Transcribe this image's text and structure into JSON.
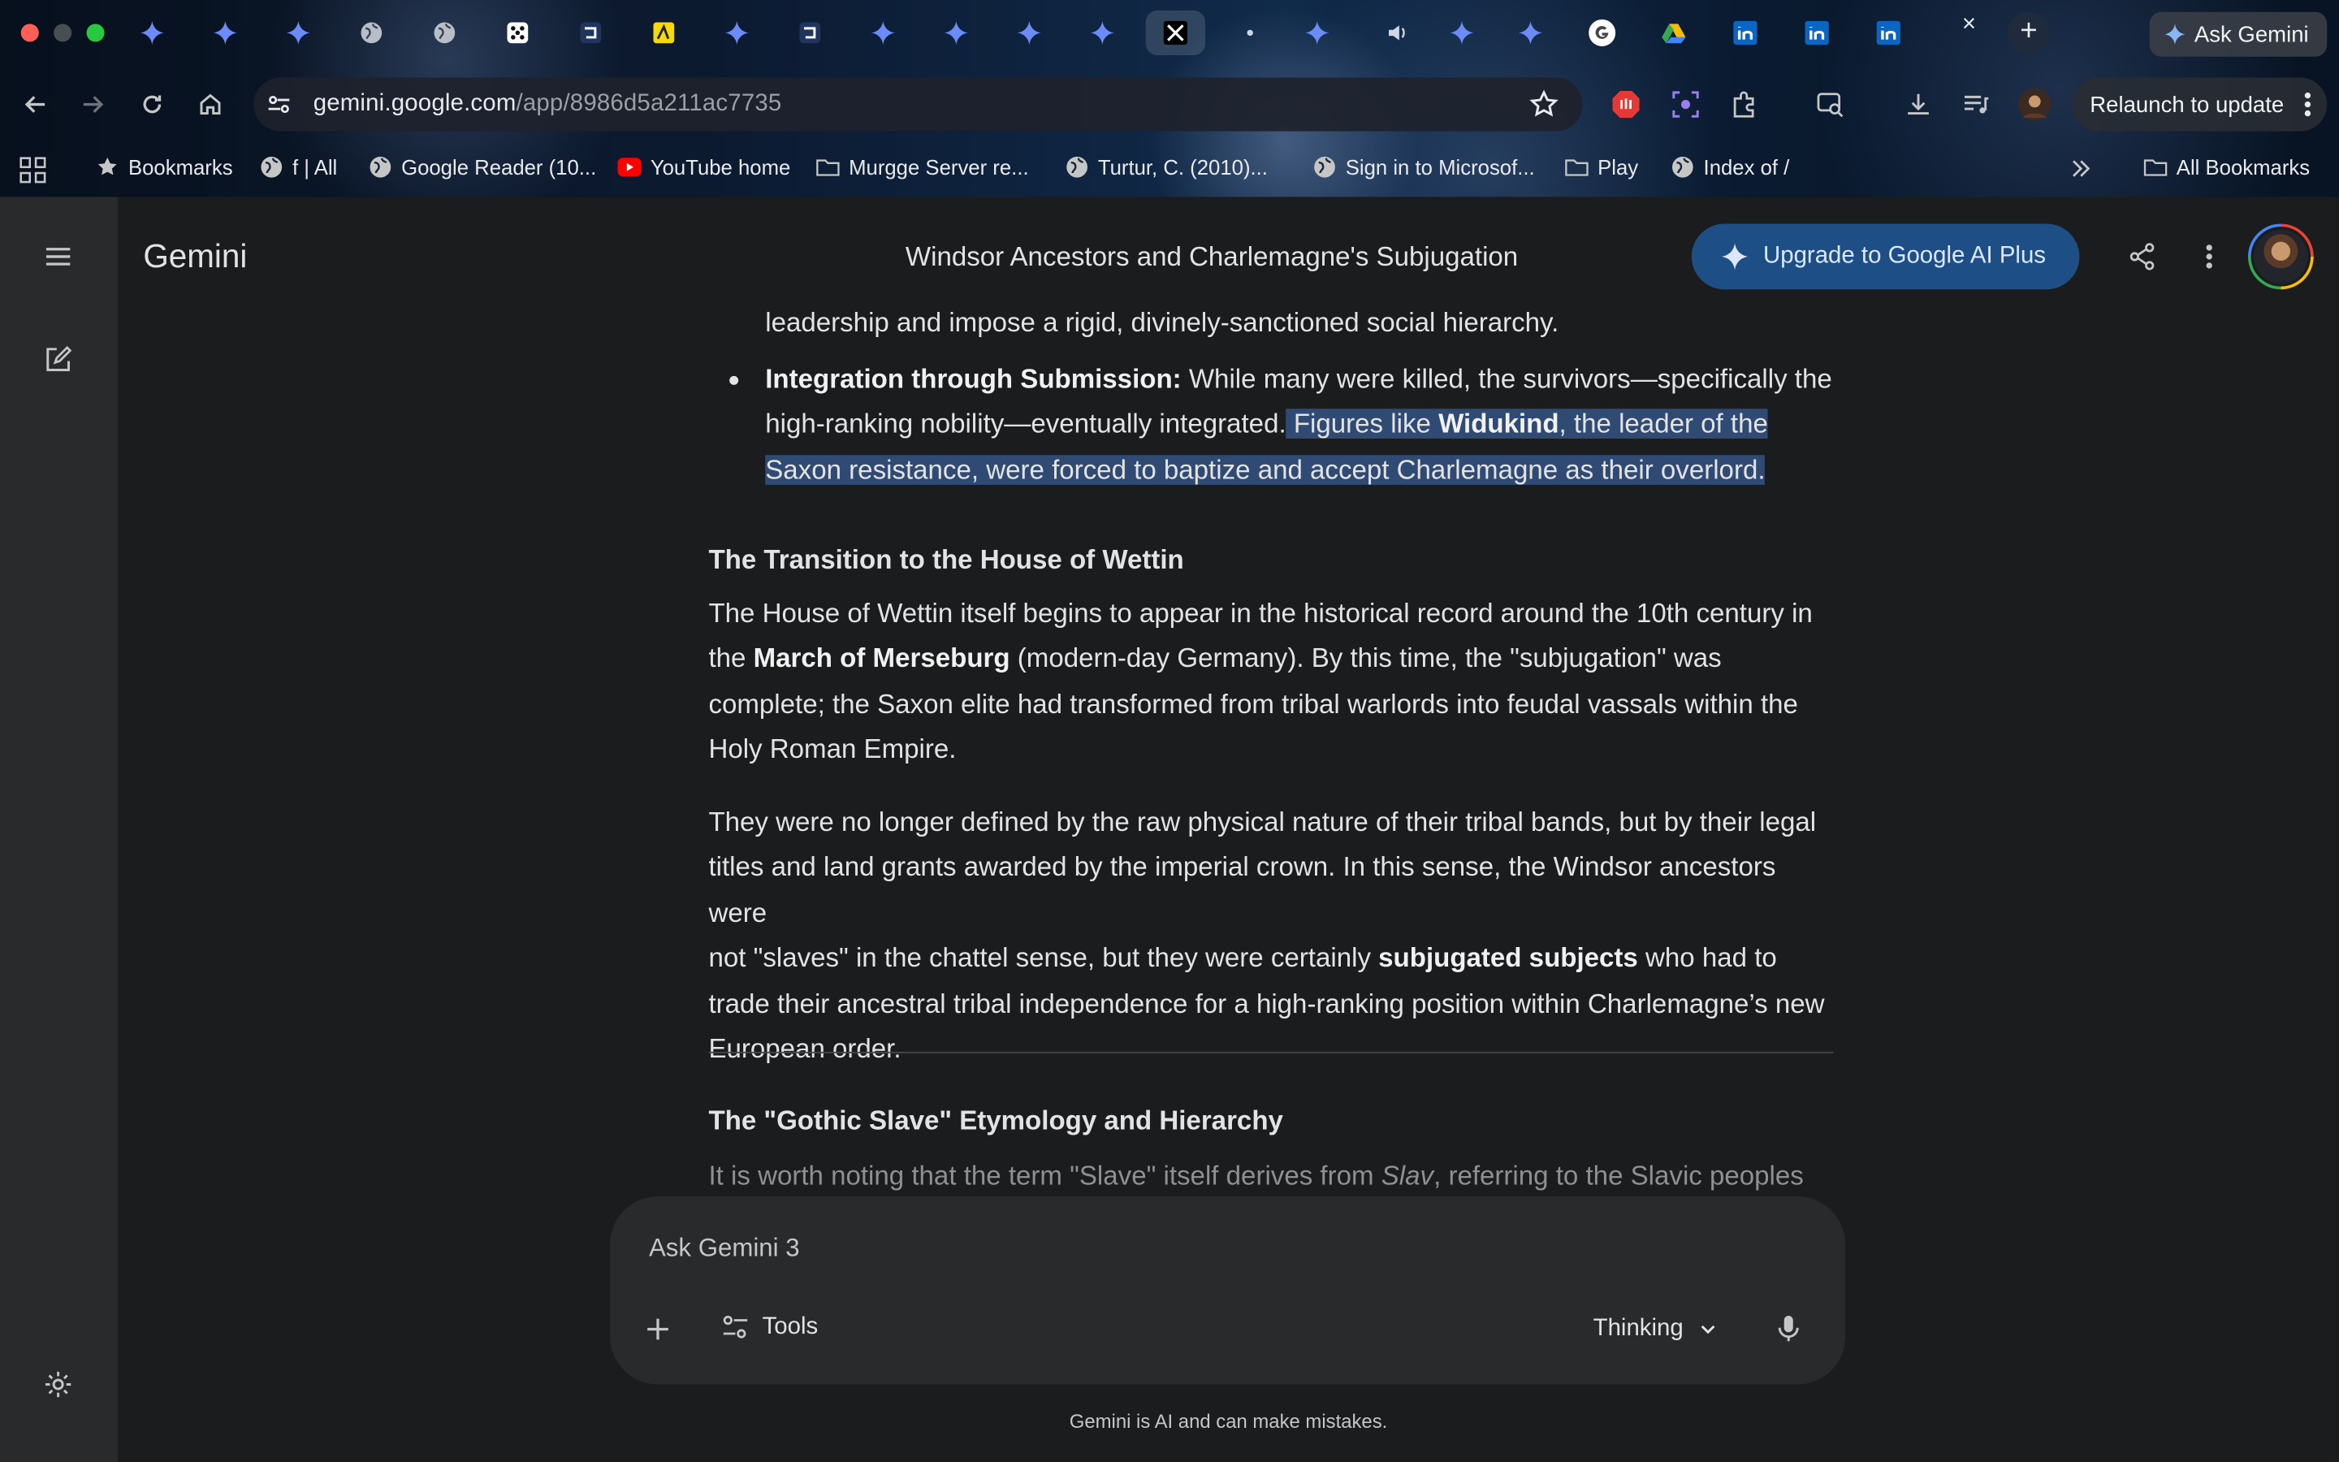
{
  "browser": {
    "tab_close_glyph": "×",
    "new_tab_glyph": "+",
    "ask_gemini_label": "Ask Gemini",
    "url_host": "gemini.google.com",
    "url_path": "/app/8986d5a211ac7735",
    "relaunch_label": "Relaunch to update",
    "bookmarks": [
      {
        "label": "Bookmarks",
        "icon": "star-icon"
      },
      {
        "label": "f | All",
        "icon": "globe-icon"
      },
      {
        "label": "Google Reader (10...",
        "icon": "globe-icon"
      },
      {
        "label": "YouTube home",
        "icon": "youtube-icon"
      },
      {
        "label": "Murgge Server re...",
        "icon": "folder-icon"
      },
      {
        "label": "Turtur, C. (2010)...",
        "icon": "globe-icon"
      },
      {
        "label": "Sign in to Microsof...",
        "icon": "globe-icon"
      },
      {
        "label": "Play",
        "icon": "folder-icon"
      },
      {
        "label": "Index of /",
        "icon": "globe-icon"
      }
    ],
    "all_bookmarks_label": "All Bookmarks"
  },
  "app": {
    "brand": "Gemini",
    "conversation_title": "Windsor Ancestors and Charlemagne's Subjugation",
    "upgrade_label": "Upgrade to Google AI Plus"
  },
  "article": {
    "top_line": "leadership and impose a rigid, divinely-sanctioned social hierarchy.",
    "bullet_label": "Integration through Submission:",
    "bullet_line1_rest": " While many were killed, the survivors—specifically the",
    "bullet_line2_plain": "high-ranking nobility—eventually integrated.",
    "bullet_line2_sel_a": " Figures like ",
    "bullet_line2_bold": "Widukind",
    "bullet_line2_sel_b": ", the leader of the",
    "bullet_line3_sel": "Saxon resistance, were forced to baptize and accept Charlemagne as their overlord.",
    "h_wettin": "The Transition to the House of Wettin",
    "p1_l1": "The House of Wettin itself begins to appear in the historical record around the 10th century in",
    "p1_l2_a": "the ",
    "p1_l2_bold": "March of Merseburg",
    "p1_l2_b": " (modern-day Germany). By this time, the \"subjugation\" was",
    "p1_l3": "complete; the Saxon elite had transformed from tribal warlords into feudal vassals within the",
    "p1_l4": "Holy Roman Empire.",
    "p2_l1": "They were no longer defined by the raw physical nature of their tribal bands, but by their legal",
    "p2_l2": "titles and land grants awarded by the imperial crown. In this sense, the Windsor ancestors were",
    "p2_l3_a": "not \"slaves\" in the chattel sense, but they were certainly ",
    "p2_l3_bold": "subjugated subjects",
    "p2_l3_b": " who had to",
    "p2_l4": "trade their ancestral tribal independence for a high-ranking position within Charlemagne’s new",
    "p2_l5": "European order.",
    "h_gothic": "The \"Gothic Slave\" Etymology and Hierarchy",
    "p3_l1_a": "It is worth noting that the term \"Slave\" itself derives from ",
    "p3_l1_italic": "Slav",
    "p3_l1_b": ", referring to the Slavic peoples"
  },
  "composer": {
    "placeholder": "Ask Gemini 3",
    "tools_label": "Tools",
    "mode_label": "Thinking"
  },
  "disclaimer": "Gemini is AI and can make mistakes.",
  "colors": {
    "background": "#1b1c1d",
    "sidebar": "#282a2c",
    "selection": "#2f4a73",
    "upgrade_button": "#1d4f86",
    "text": "#e3e3e3"
  }
}
